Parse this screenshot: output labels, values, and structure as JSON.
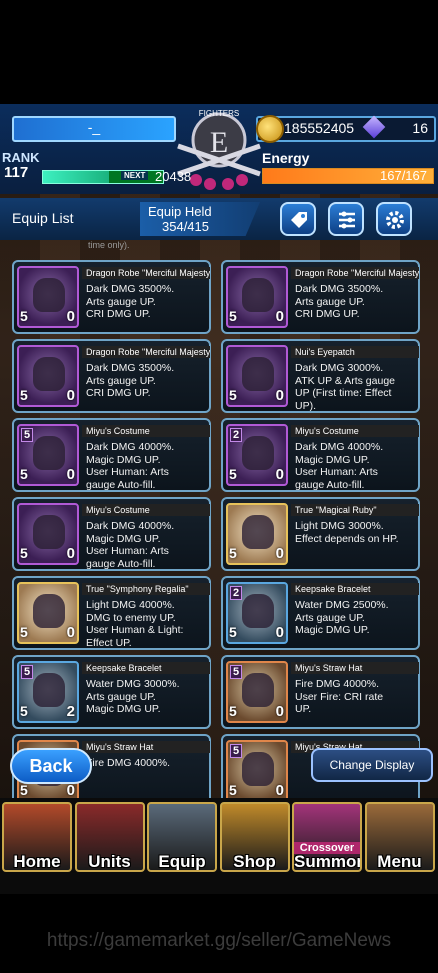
{
  "header": {
    "player_name": "-_",
    "gold": "185552405",
    "gems": "16",
    "rank_label": "RANK",
    "rank": "117",
    "next_label": "NEXT",
    "next_exp": "20438",
    "exp_fraction": 0.55,
    "energy_label": "Energy",
    "energy": "167/167",
    "energy_fraction": 1.0,
    "emblem_text": "FIGHTERS",
    "emblem_letter": "E"
  },
  "equip_bar": {
    "title": "Equip List",
    "held_label": "Equip Held",
    "held_value": "354/415"
  },
  "partial_top": "time only).",
  "items": [
    {
      "name": "Dragon Robe \"Merciful Majesty\"",
      "desc": "Dark DMG 3500%.\nArts gauge UP.\nCRI DMG UP.",
      "stars": "5",
      "count": "0",
      "style": "dark",
      "level": ""
    },
    {
      "name": "Dragon Robe \"Merciful Majesty\"",
      "desc": "Dark DMG 3500%.\nArts gauge UP.\nCRI DMG UP.",
      "stars": "5",
      "count": "0",
      "style": "dark",
      "level": ""
    },
    {
      "name": "Dragon Robe \"Merciful Majesty\"",
      "desc": "Dark DMG 3500%.\nArts gauge UP.\nCRI DMG UP.",
      "stars": "5",
      "count": "0",
      "style": "dark",
      "level": ""
    },
    {
      "name": "Nui's Eyepatch",
      "desc": "Dark DMG 3000%.\nATK UP & Arts gauge\nUP (First time: Effect\nUP).",
      "stars": "5",
      "count": "0",
      "style": "dark",
      "level": ""
    },
    {
      "name": "Miyu's Costume",
      "desc": "Dark DMG 4000%.\nMagic DMG UP.\nUser Human: Arts\ngauge Auto-fill.",
      "stars": "5",
      "count": "0",
      "style": "dark",
      "level": "5"
    },
    {
      "name": "Miyu's Costume",
      "desc": "Dark DMG 4000%.\nMagic DMG UP.\nUser Human: Arts\ngauge Auto-fill.",
      "stars": "5",
      "count": "0",
      "style": "dark",
      "level": "2"
    },
    {
      "name": "Miyu's Costume",
      "desc": "Dark DMG 4000%.\nMagic DMG UP.\nUser Human: Arts\ngauge Auto-fill.",
      "stars": "5",
      "count": "0",
      "style": "dark",
      "level": ""
    },
    {
      "name": "True \"Magical Ruby\"",
      "desc": "Light DMG 3000%.\nEffect depends on HP.",
      "stars": "5",
      "count": "0",
      "style": "light",
      "level": ""
    },
    {
      "name": "True \"Symphony Regalia\"",
      "desc": "Light DMG 4000%.\nDMG to enemy UP.\nUser Human & Light:\nEffect UP.",
      "stars": "5",
      "count": "0",
      "style": "light",
      "level": ""
    },
    {
      "name": "Keepsake Bracelet",
      "desc": "Water DMG 2500%.\nArts gauge UP.\nMagic DMG UP.",
      "stars": "5",
      "count": "0",
      "style": "water",
      "level": "2"
    },
    {
      "name": "Keepsake Bracelet",
      "desc": "Water DMG 3000%.\nArts gauge UP.\nMagic DMG UP.",
      "stars": "5",
      "count": "2",
      "style": "water",
      "level": "5"
    },
    {
      "name": "Miyu's Straw Hat",
      "desc": "Fire DMG 4000%.\nUser Fire: CRI rate\nUP.",
      "stars": "5",
      "count": "0",
      "style": "fire",
      "level": "5"
    },
    {
      "name": "Miyu's Straw Hat",
      "desc": "Fire DMG 4000%.",
      "stars": "5",
      "count": "0",
      "style": "fire",
      "level": ""
    },
    {
      "name": "Miyu's Straw Hat",
      "desc": "",
      "stars": "5",
      "count": "0",
      "style": "fire",
      "level": "5"
    }
  ],
  "buttons": {
    "back": "Back",
    "change_display": "Change Display"
  },
  "nav": [
    {
      "label": "Home",
      "color": "#b34a2a"
    },
    {
      "label": "Units",
      "color": "#8a2a2a"
    },
    {
      "label": "Equip",
      "color": "#5a6a7a"
    },
    {
      "label": "Shop",
      "color": "#c08a2a"
    },
    {
      "label": "Summon",
      "color": "#a3347a",
      "badge": "Crossover"
    },
    {
      "label": "Menu",
      "color": "#9a6a3a"
    }
  ],
  "watermark": "https://gamemarket.gg/seller/GameNews"
}
